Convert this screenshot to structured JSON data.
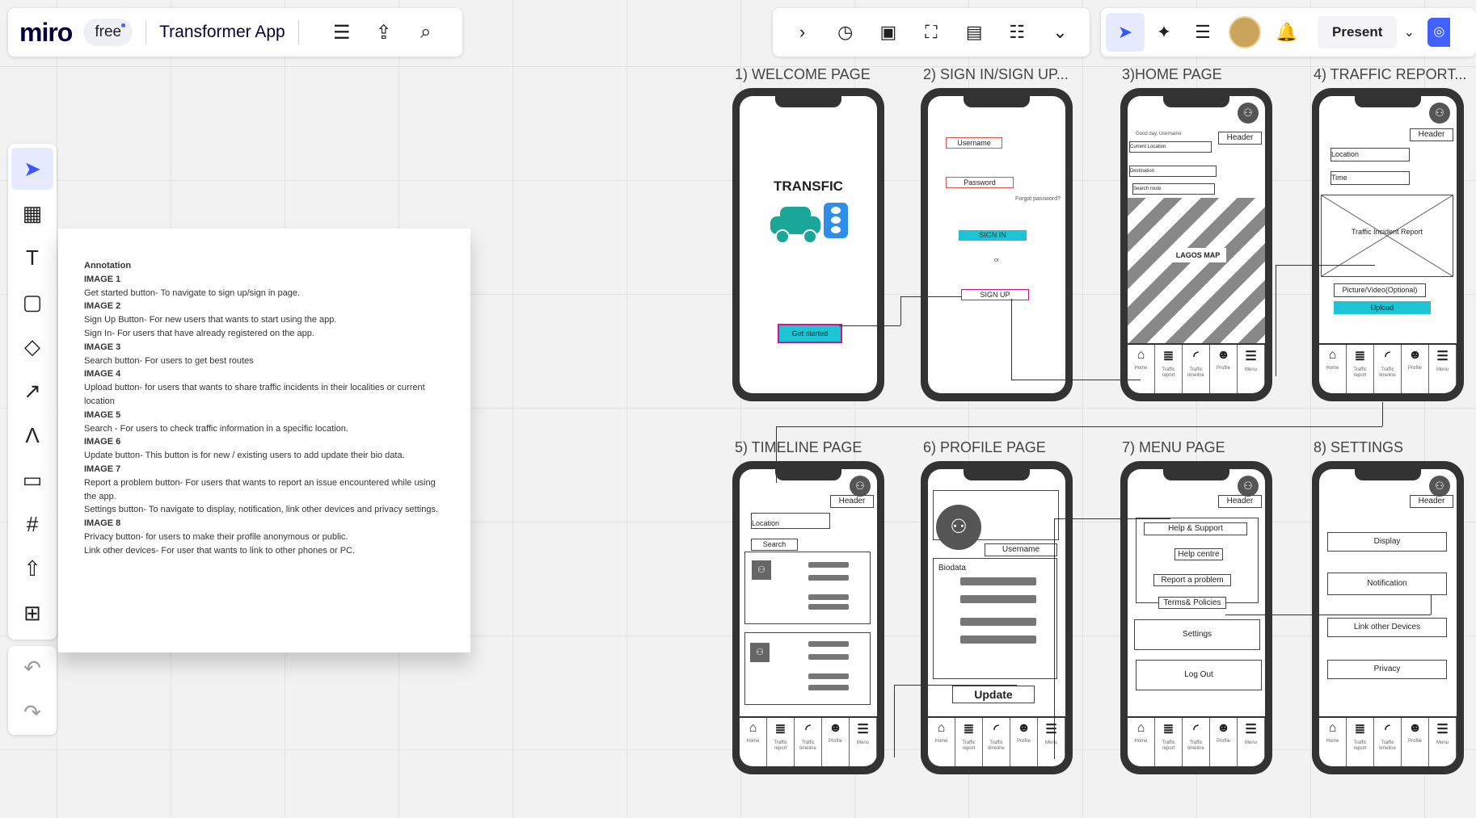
{
  "topbar": {
    "logo": "miro",
    "plan_badge": "free",
    "board_title": "Transformer App",
    "menu_icon": "hamburger-icon",
    "export_icon": "upload-icon",
    "search_icon": "search-icon",
    "present_label": "Present"
  },
  "annotation": {
    "lines": [
      {
        "t": "Annotation",
        "b": true
      },
      {
        "t": "IMAGE 1",
        "b": true
      },
      {
        "t": "Get started button- To navigate to sign up/sign in page."
      },
      {
        "t": "IMAGE 2",
        "b": true
      },
      {
        "t": "Sign Up Button- For new users that wants to start using the app."
      },
      {
        "t": "Sign In- For users that have already registered on the app."
      },
      {
        "t": "IMAGE 3",
        "b": true
      },
      {
        "t": "Search button- For users to get  best routes"
      },
      {
        "t": "IMAGE 4",
        "b": true
      },
      {
        "t": "Upload  button- for users that wants to share traffic incidents in their localities or current location"
      },
      {
        "t": "IMAGE 5",
        "b": true
      },
      {
        "t": "Search - For users to check traffic information  in a specific location."
      },
      {
        "t": "IMAGE 6",
        "b": true
      },
      {
        "t": "Update button- This button is for new / existing users to add update their bio data."
      },
      {
        "t": "IMAGE 7",
        "b": true
      },
      {
        "t": "Report a problem button- For users that wants to report an issue encountered while using the app."
      },
      {
        "t": "Settings button- To navigate to display, notification, link other devices and privacy settings."
      },
      {
        "t": "IMAGE 8",
        "b": true
      },
      {
        "t": "Privacy button- for users to  make their profile anonymous or public."
      },
      {
        "t": "Link other devices- For user that wants to link to other phones or PC."
      }
    ]
  },
  "frames": {
    "f1": "1) WELCOME PAGE",
    "f2": "2) SIGN IN/SIGN UP...",
    "f3": "3)HOME PAGE",
    "f4": "4) TRAFFIC REPORT...",
    "f5": "5) TIMELINE PAGE",
    "f6": "6) PROFILE PAGE",
    "f7": "7) MENU PAGE",
    "f8": "8) SETTINGS"
  },
  "welcome": {
    "brand": "TRANSFIC",
    "cta": "Get started"
  },
  "signin": {
    "username": "Username",
    "password": "Password",
    "forgot": "Forgot password?",
    "signin": "SIGN IN",
    "or": "or",
    "signup": "SIGN UP"
  },
  "home": {
    "greeting": "Good day,  Username",
    "header": "Header",
    "current": "Current Location",
    "destination": "Destination",
    "search": "Search route",
    "map": "LAGOS MAP"
  },
  "traffic": {
    "header": "Header",
    "location": "Location",
    "time": "Time",
    "report": "Traffic Incident Report",
    "media": "Picture/Video(Optional)",
    "upload": "Upload"
  },
  "timeline": {
    "header": "Header",
    "location": "Location",
    "search": "Search"
  },
  "profile": {
    "username": "Username",
    "biodata": "Biodata",
    "update": "Update"
  },
  "menu": {
    "header": "Header",
    "help": "Help & Support",
    "centre": "Help centre",
    "report": "Report a problem",
    "terms": "Terms& Policies",
    "settings": "Settings",
    "logout": "Log Out"
  },
  "settings": {
    "header": "Header",
    "display": "Display",
    "notification": "Notification",
    "link": "Link other Devices",
    "privacy": "Privacy"
  },
  "nav": {
    "home": "Home",
    "traffic": "Traffic report",
    "timeline": "Traffic timeline",
    "profile": "Profile",
    "menu": "Menu"
  }
}
